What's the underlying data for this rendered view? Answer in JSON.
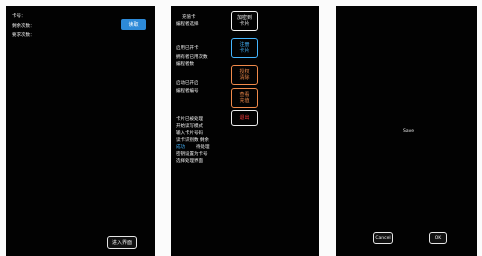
{
  "panel1": {
    "labels": [
      "卡号：",
      "剩余次数：",
      "要求次数："
    ],
    "top_button": "读取",
    "bottom_button": "进入界面"
  },
  "panel2": {
    "groups": [
      {
        "lines": [
          "充值卡",
          "编程者选择"
        ]
      },
      {
        "lines": [
          "启用已开卡",
          "拥有者已用次数",
          "编程者数"
        ]
      },
      {
        "lines": [
          "启动已开启",
          "编程者编号"
        ]
      },
      {
        "lines": [
          "卡片已被处理",
          "开始读写模式",
          "输入卡片号码",
          "读卡识别数 剩余",
          "成功",
          "待处理",
          "密钥设置为卡号",
          "选择处理界面"
        ]
      }
    ],
    "buttons": [
      {
        "label": "加密到\n卡片",
        "color": "#f0f0f0"
      },
      {
        "label": "注册\n卡片",
        "color": "#45b6ff"
      },
      {
        "label": "授权\n清除",
        "color": "#f08a4b"
      },
      {
        "label": "查看\n充值",
        "color": "#f08a4b"
      },
      {
        "label": "退出",
        "color": "#ff3b3b"
      }
    ]
  },
  "panel3": {
    "center_text": "Save",
    "cancel_button": "Cancel",
    "ok_button": "OK"
  }
}
